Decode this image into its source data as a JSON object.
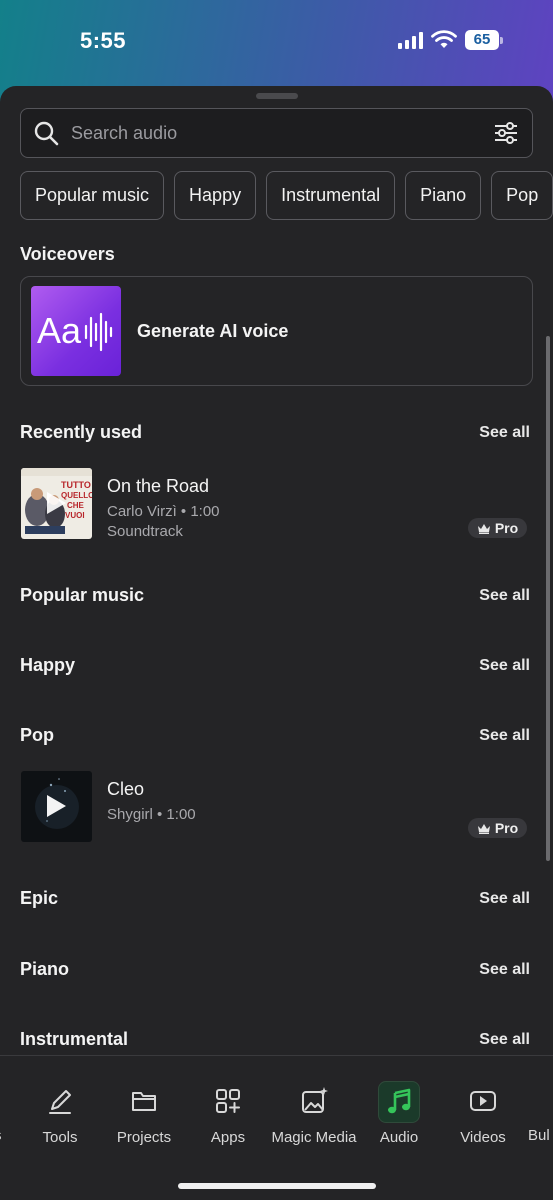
{
  "status_bar": {
    "time": "5:55",
    "battery": "65"
  },
  "search": {
    "placeholder": "Search audio"
  },
  "chips": [
    "Popular music",
    "Happy",
    "Instrumental",
    "Piano",
    "Pop"
  ],
  "voiceovers": {
    "title": "Voiceovers",
    "card_label": "Generate AI voice",
    "thumb_text": "Aa"
  },
  "see_all": "See all",
  "recently_used": {
    "title": "Recently used",
    "tracks": [
      {
        "title": "On the Road",
        "meta": "Carlo Virzì • 1:00",
        "genre": "Soundtrack",
        "badge": "Pro"
      }
    ]
  },
  "sections": {
    "popular_music": "Popular music",
    "happy": "Happy",
    "pop": "Pop",
    "epic": "Epic",
    "piano": "Piano",
    "instrumental": "Instrumental"
  },
  "pop_tracks": [
    {
      "title": "Cleo",
      "meta": "Shygirl • 1:00",
      "badge": "Pro"
    }
  ],
  "nav": {
    "items": [
      {
        "label": "s",
        "icon": "partial-icon"
      },
      {
        "label": "Tools",
        "icon": "pen-icon"
      },
      {
        "label": "Projects",
        "icon": "folder-icon"
      },
      {
        "label": "Apps",
        "icon": "apps-icon"
      },
      {
        "label": "Magic Media",
        "icon": "magic-media-icon"
      },
      {
        "label": "Audio",
        "icon": "music-note-icon",
        "active": true
      },
      {
        "label": "Videos",
        "icon": "play-icon"
      },
      {
        "label": "Bul",
        "icon": "partial-icon"
      }
    ]
  },
  "colors": {
    "accent_green": "#35c45a",
    "sheet_bg": "#242426",
    "voice_purple": "#8a3be8"
  }
}
